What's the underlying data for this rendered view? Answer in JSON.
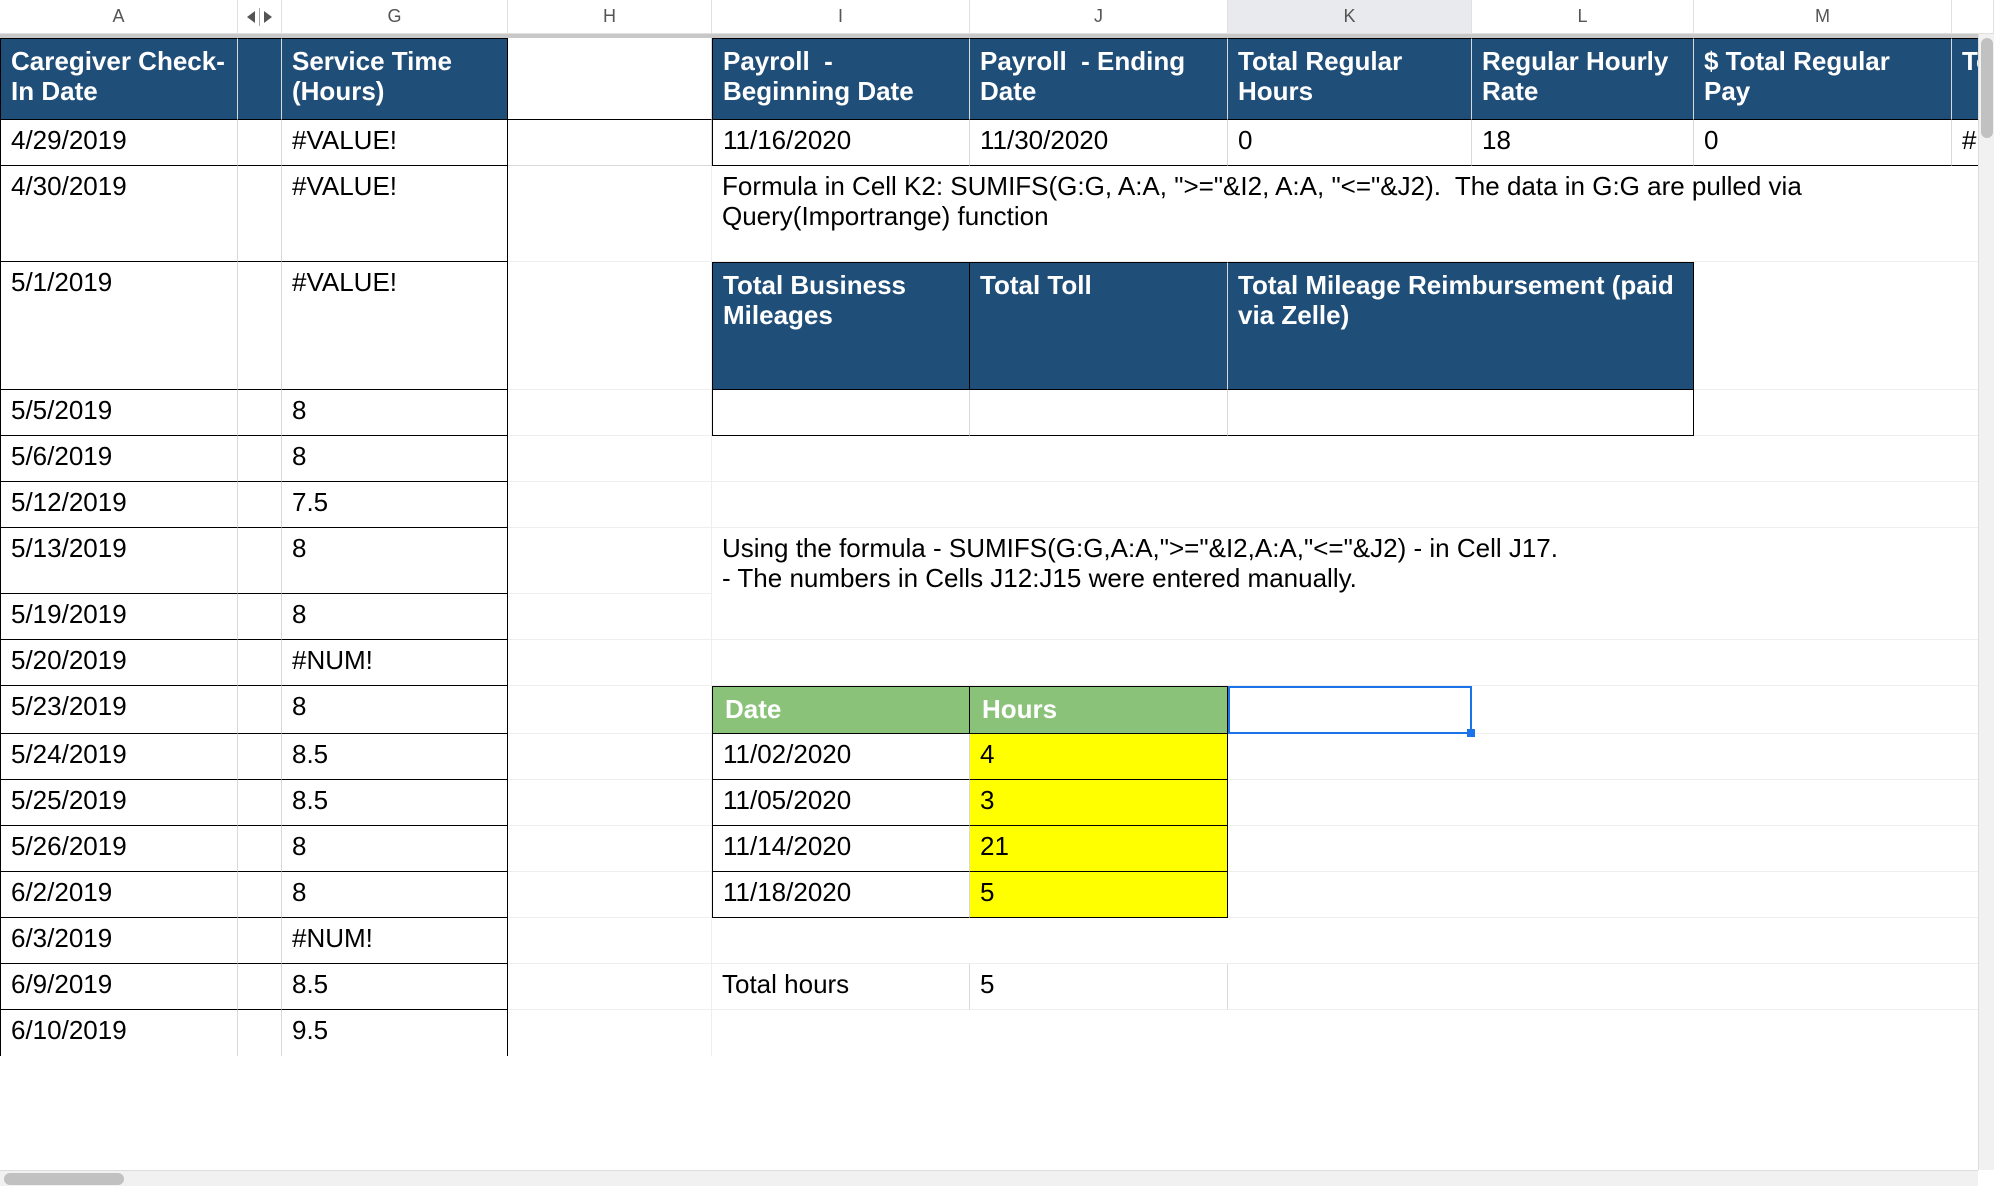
{
  "columns": {
    "A": "A",
    "G": "G",
    "H": "H",
    "I": "I",
    "J": "J",
    "K": "K",
    "L": "L",
    "M": "M"
  },
  "header_row": {
    "A": "Caregiver Check-In Date",
    "G": "Service Time (Hours)",
    "H": "",
    "I": "Payroll  - Beginning Date",
    "J": "Payroll  - Ending Date",
    "K": "Total Regular Hours",
    "L": "Regular Hourly Rate",
    "M": "$ Total Regular Pay",
    "N": "Total Hou"
  },
  "row2": {
    "A": "4/29/2019",
    "G": "#VALUE!",
    "I": "11/16/2020",
    "J": "11/30/2020",
    "K": "0",
    "L": "18",
    "M": "0",
    "N": "#N/"
  },
  "formula_note1": "Formula in Cell K2: SUMIFS(G:G, A:A, \">=\"&I2, A:A, \"<=\"&J2).  The data in G:G are pulled via Query(Importrange) function",
  "row3": {
    "A": "4/30/2019",
    "G": "#VALUE!"
  },
  "row4": {
    "A": "5/1/2019",
    "G": "#VALUE!"
  },
  "mileage_headers": {
    "I": "Total Business Mileages",
    "J": "Total Toll",
    "K": "Total Mileage Reimbursement (paid via Zelle)"
  },
  "rows_left": [
    {
      "A": "5/5/2019",
      "G": "8"
    },
    {
      "A": "5/6/2019",
      "G": "8"
    },
    {
      "A": "5/12/2019",
      "G": "7.5"
    },
    {
      "A": "5/13/2019",
      "G": "8"
    },
    {
      "A": "5/19/2019",
      "G": "8"
    },
    {
      "A": "5/20/2019",
      "G": "#NUM!"
    },
    {
      "A": "5/23/2019",
      "G": "8"
    },
    {
      "A": "5/24/2019",
      "G": "8.5"
    },
    {
      "A": "5/25/2019",
      "G": "8.5"
    },
    {
      "A": "5/26/2019",
      "G": "8"
    },
    {
      "A": "6/2/2019",
      "G": "8"
    },
    {
      "A": "6/3/2019",
      "G": "#NUM!"
    },
    {
      "A": "6/9/2019",
      "G": "8.5"
    },
    {
      "A": "6/10/2019",
      "G": "9.5"
    }
  ],
  "formula_note2": "Using the formula - SUMIFS(G:G,A:A,\">=\"&I2,A:A,\"<=\"&J2) - in Cell J17.\n- The numbers in Cells J12:J15 were entered manually.",
  "small_table_headers": {
    "date": "Date",
    "hours": "Hours"
  },
  "small_table_rows": [
    {
      "date": "11/02/2020",
      "hours": "4"
    },
    {
      "date": "11/05/2020",
      "hours": "3"
    },
    {
      "date": "11/14/2020",
      "hours": "21"
    },
    {
      "date": "11/18/2020",
      "hours": "5"
    }
  ],
  "totals": {
    "label": "Total hours",
    "value": "5"
  },
  "active_column": "K"
}
